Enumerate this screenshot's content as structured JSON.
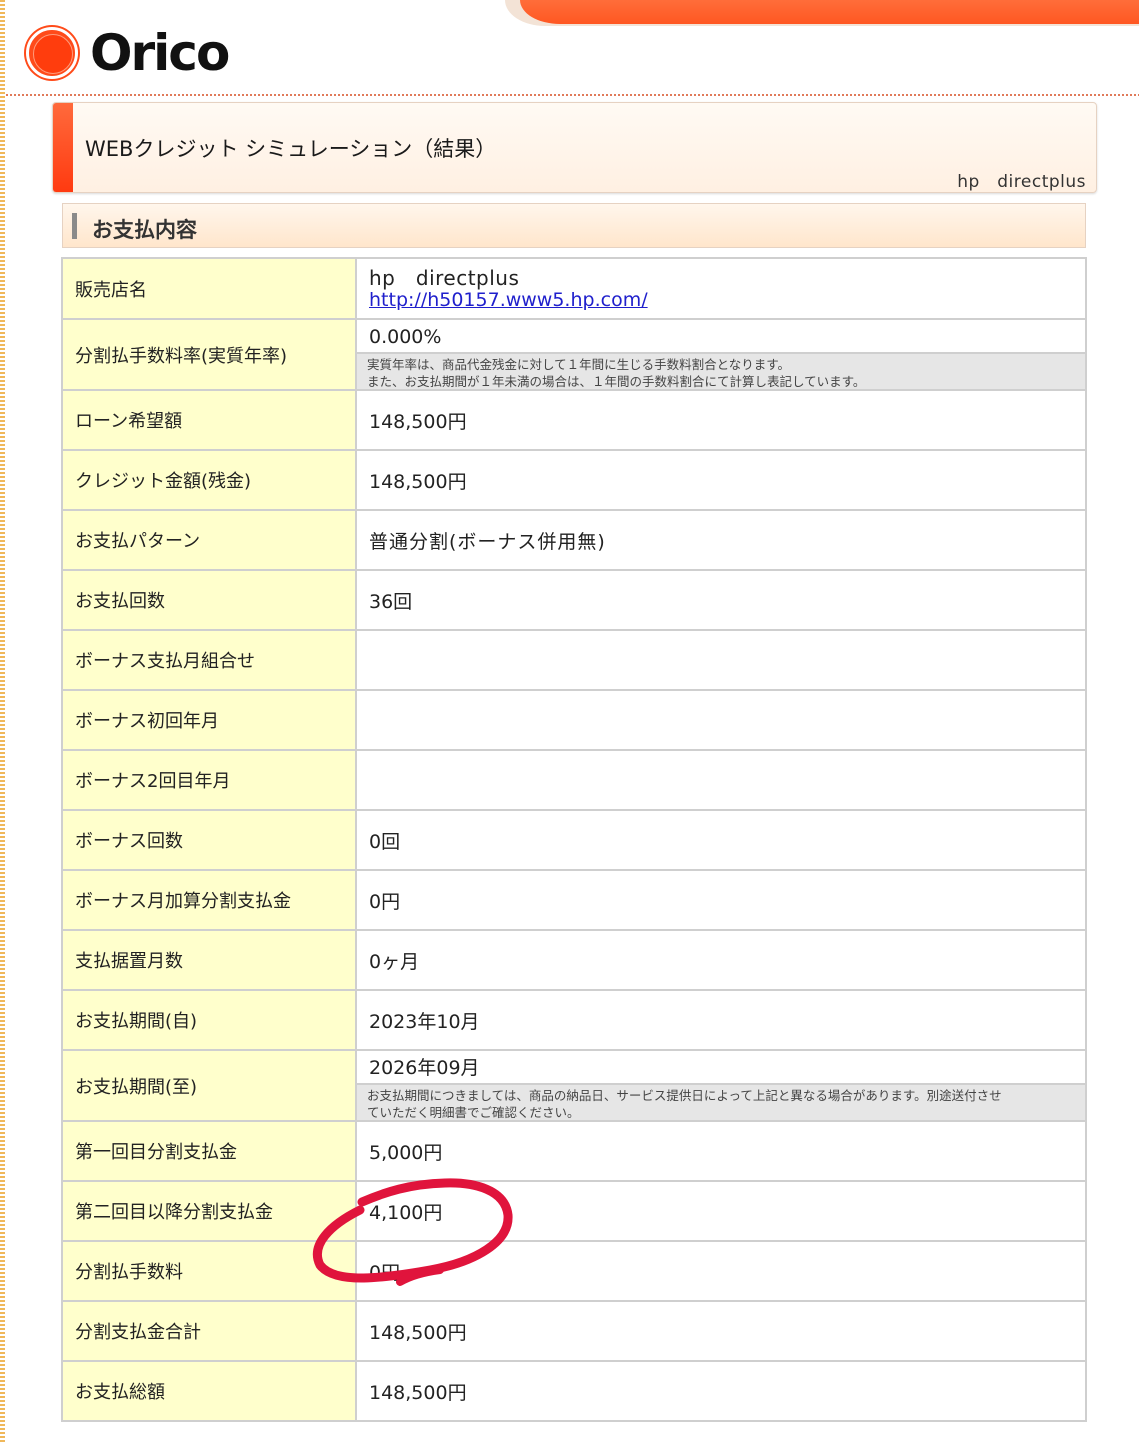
{
  "brand": {
    "logo_text": "Orico"
  },
  "title": {
    "main": "WEBクレジット シミュレーション（結果）",
    "shop": "hp　directplus"
  },
  "section": {
    "heading": "お支払内容"
  },
  "rows": {
    "shop": {
      "label": "販売店名",
      "name": "hp　directplus",
      "url": "http://h50157.www5.hp.com/"
    },
    "rate": {
      "label": "分割払手数料率(実質年率)",
      "value": "0.000%",
      "note_line1": "実質年率は、商品代金残金に対して１年間に生じる手数料割合となります。",
      "note_line2": "また、お支払期間が１年未満の場合は、１年間の手数料割合にて計算し表記しています。"
    },
    "loan": {
      "label": "ローン希望額",
      "value": "148,500円"
    },
    "credit": {
      "label": "クレジット金額(残金)",
      "value": "148,500円"
    },
    "pattern": {
      "label": "お支払パターン",
      "value": "普通分割(ボーナス併用無)"
    },
    "count": {
      "label": "お支払回数",
      "value": "36回"
    },
    "bonus_combo": {
      "label": "ボーナス支払月組合せ",
      "value": ""
    },
    "bonus_first": {
      "label": "ボーナス初回年月",
      "value": ""
    },
    "bonus_second": {
      "label": "ボーナス2回目年月",
      "value": ""
    },
    "bonus_count": {
      "label": "ボーナス回数",
      "value": "0回"
    },
    "bonus_add": {
      "label": "ボーナス月加算分割支払金",
      "value": "0円"
    },
    "deferral": {
      "label": "支払据置月数",
      "value": "0ヶ月"
    },
    "period_from": {
      "label": "お支払期間(自)",
      "value": "2023年10月"
    },
    "period_to": {
      "label": "お支払期間(至)",
      "value": "2026年09月",
      "note_line1": "お支払期間につきましては、商品の納品日、サービス提供日によって上記と異なる場合があります。別途送付させ",
      "note_line2": "ていただく明細書でご確認ください。"
    },
    "first_payment": {
      "label": "第一回目分割支払金",
      "value": "5,000円"
    },
    "later_payment": {
      "label": "第二回目以降分割支払金",
      "value": "4,100円"
    },
    "fee": {
      "label": "分割払手数料",
      "value": "0円"
    },
    "installment_total": {
      "label": "分割支払金合計",
      "value": "148,500円"
    },
    "grand_total": {
      "label": "お支払総額",
      "value": "148,500円"
    }
  },
  "colors": {
    "accent": "#ff5722",
    "label_bg": "#ffffcc",
    "annotation": "#e0143c"
  }
}
